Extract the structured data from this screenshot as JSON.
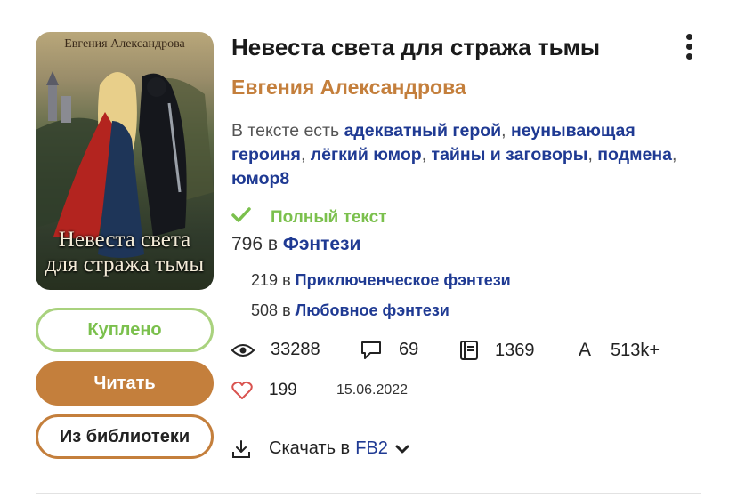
{
  "book": {
    "cover_author": "Евгения Александрова",
    "cover_title_line1": "Невеста света",
    "cover_title_line2": "для стража тьмы",
    "title": "Невеста света для стража тьмы",
    "author": "Евгения Александрова"
  },
  "buttons": {
    "bought": "Куплено",
    "read": "Читать",
    "remove": "Из библиотеки"
  },
  "tags": {
    "prefix": "В тексте есть",
    "items": [
      "адекватный герой",
      "неунывающая героиня",
      "лёгкий юмор",
      "тайны и заговоры",
      "подмена",
      "юмор8"
    ]
  },
  "status": {
    "full_text": "Полный текст"
  },
  "ranks": {
    "main": {
      "position": "796",
      "sep": "в",
      "genre": "Фэнтези"
    },
    "sub": [
      {
        "position": "219",
        "sep": "в",
        "genre": "Приключенческое фэнтези"
      },
      {
        "position": "508",
        "sep": "в",
        "genre": "Любовное фэнтези"
      }
    ]
  },
  "stats": {
    "views": "33288",
    "comments": "69",
    "pages": "1369",
    "chars_label": "A",
    "chars": "513k+",
    "likes": "199",
    "date": "15.06.2022"
  },
  "download": {
    "label": "Скачать в",
    "format": "FB2"
  },
  "icons": {
    "views": "eye-icon",
    "comments": "comment-icon",
    "pages": "book-icon",
    "likes": "heart-icon",
    "download": "download-icon",
    "menu": "more-vertical-icon"
  },
  "colors": {
    "accent": "#c47f3c",
    "link": "#1f3a93",
    "green": "#7bc04d",
    "heart": "#d9534f"
  }
}
